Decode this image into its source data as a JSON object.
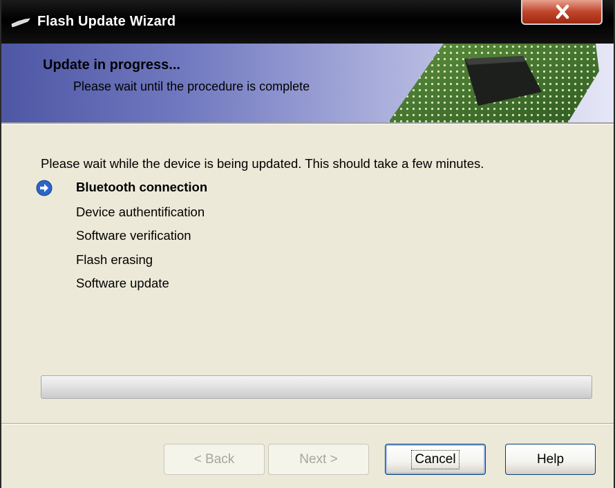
{
  "window": {
    "title": "Flash Update Wizard",
    "title_icon": "wrench-icon",
    "close_icon": "close-icon"
  },
  "header": {
    "title": "Update in progress...",
    "subtitle": "Please wait until the procedure is complete",
    "image": "circuit-chip-image"
  },
  "body": {
    "intro": "Please wait while the device is being updated. This should take a few minutes.",
    "current_step_icon": "arrow-right-circle-icon",
    "steps": [
      {
        "label": "Bluetooth connection",
        "active": true
      },
      {
        "label": "Device authentification",
        "active": false
      },
      {
        "label": "Software verification",
        "active": false
      },
      {
        "label": "Flash erasing",
        "active": false
      },
      {
        "label": "Software update",
        "active": false
      }
    ],
    "progress": 0
  },
  "buttons": {
    "back": {
      "label": "< Back",
      "enabled": false
    },
    "next": {
      "label": "Next >",
      "enabled": false
    },
    "cancel": {
      "label": "Cancel",
      "enabled": true,
      "default": true
    },
    "help": {
      "label": "Help",
      "enabled": true
    }
  },
  "colors": {
    "header_gradient_start": "#4e57a4",
    "header_gradient_end": "#e6e7f6",
    "close_button": "#c0462c",
    "step_icon": "#2a66c9",
    "dialog_background": "#ece9d8"
  }
}
